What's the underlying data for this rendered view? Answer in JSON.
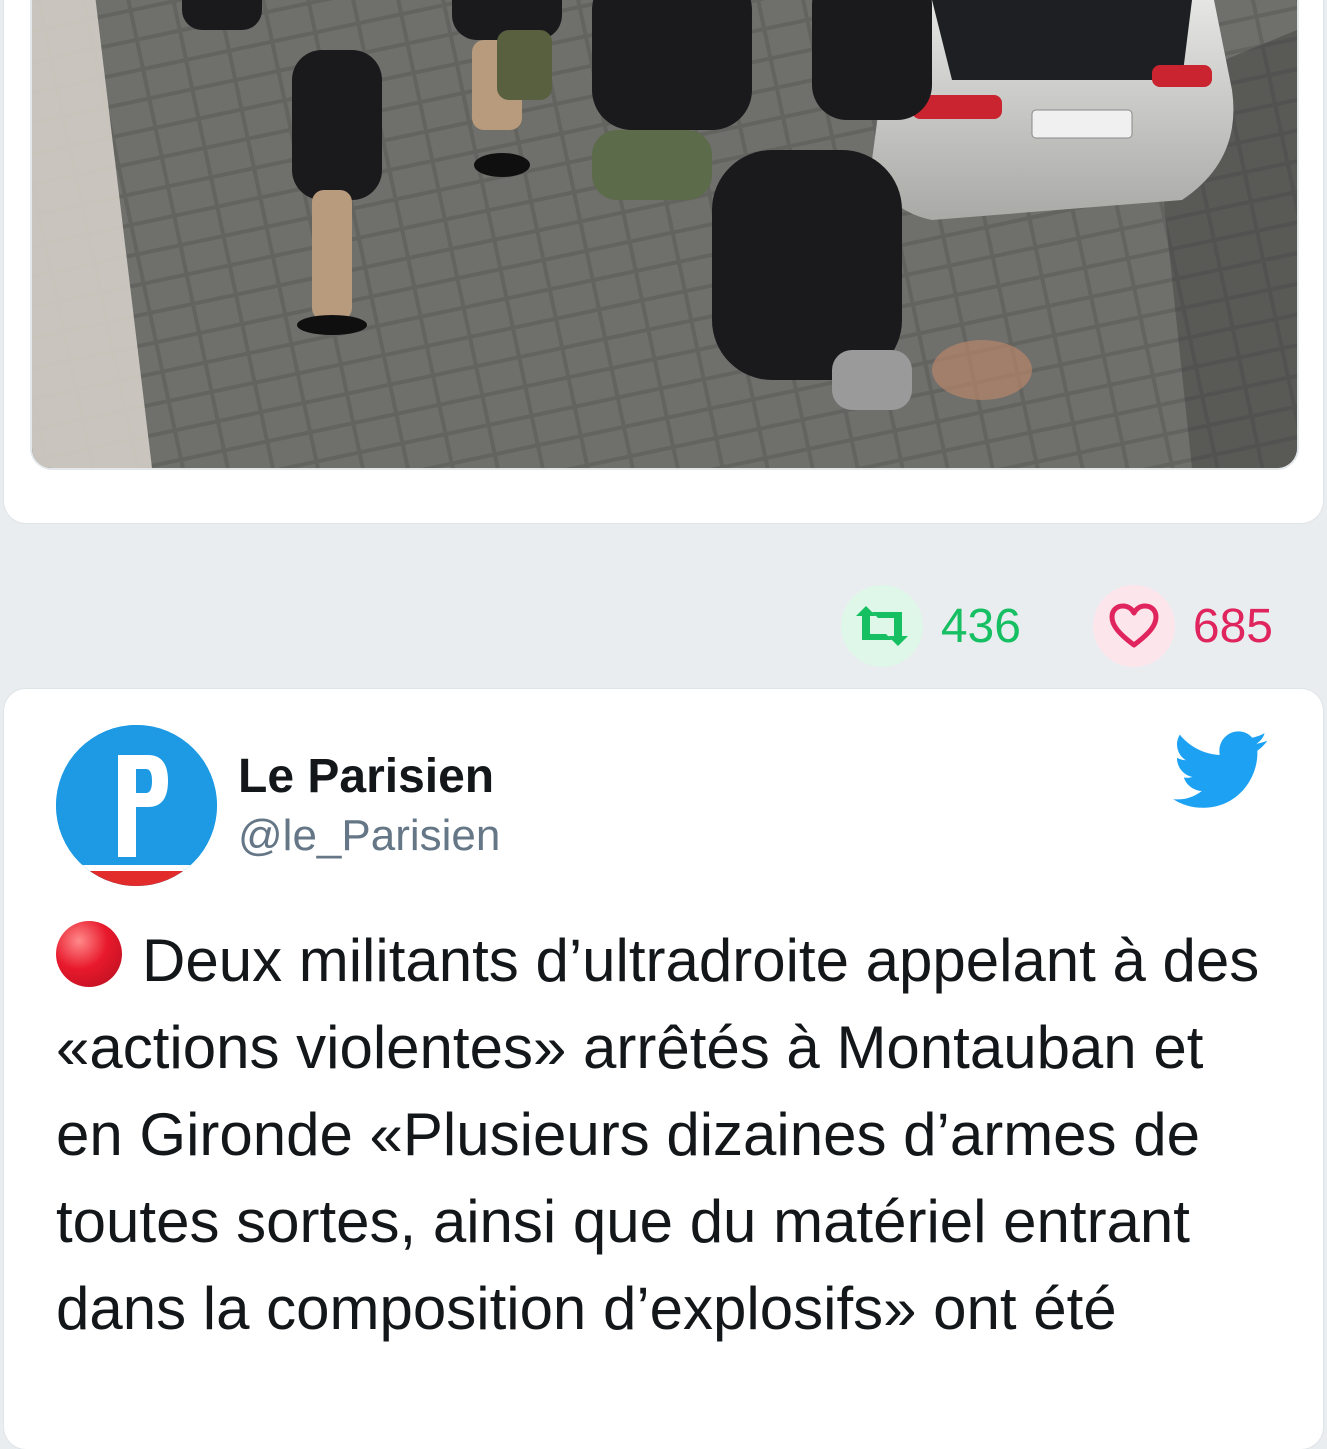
{
  "previous_tweet": {
    "media_alt": "photo",
    "retweet_count": "436",
    "like_count": "685",
    "icons": {
      "retweet": "retweet-icon",
      "like": "heart-icon"
    },
    "colors": {
      "retweet": "#17bf63",
      "like": "#e0245e"
    }
  },
  "tweet": {
    "author_name": "Le Parisien",
    "author_handle": "@le_Parisien",
    "avatar_letter": "P",
    "platform_icon": "twitter-bird-icon",
    "status_emoji": "red-circle-icon",
    "text": "Deux militants d’ultradroite appelant à des «actions violentes» arrêtés à Montauban et en Gironde «Plusieurs dizaines d’armes de toutes sortes, ainsi que du matériel entrant dans la composition d’explosifs» ont été",
    "colors": {
      "brand_blue": "#1da1f2",
      "avatar_bg": "#1d9ae3",
      "avatar_stripe": "#e22b2b"
    }
  }
}
